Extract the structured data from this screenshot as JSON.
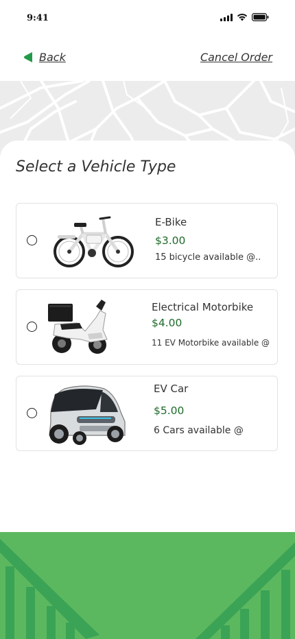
{
  "status_bar": {
    "time": "9:41"
  },
  "nav": {
    "back_label": "Back",
    "cancel_label": "Cancel Order"
  },
  "sheet": {
    "title": "Select a Vehicle Type"
  },
  "vehicles": [
    {
      "name": "E-Bike",
      "price": "$3.00",
      "availability": "15 bicycle available @..",
      "icon": "ebike-image"
    },
    {
      "name": "Electrical Motorbike",
      "price": "$4.00",
      "availability": "11 EV Motorbike available @",
      "icon": "motorbike-image"
    },
    {
      "name": "EV Car",
      "price": "$5.00",
      "availability": "6 Cars available @",
      "icon": "ev-car-image"
    }
  ],
  "colors": {
    "accent_green": "#5cb85f",
    "dark_green": "#3aa356",
    "price_green": "#1e6a2a",
    "map_gray": "#ececec"
  }
}
